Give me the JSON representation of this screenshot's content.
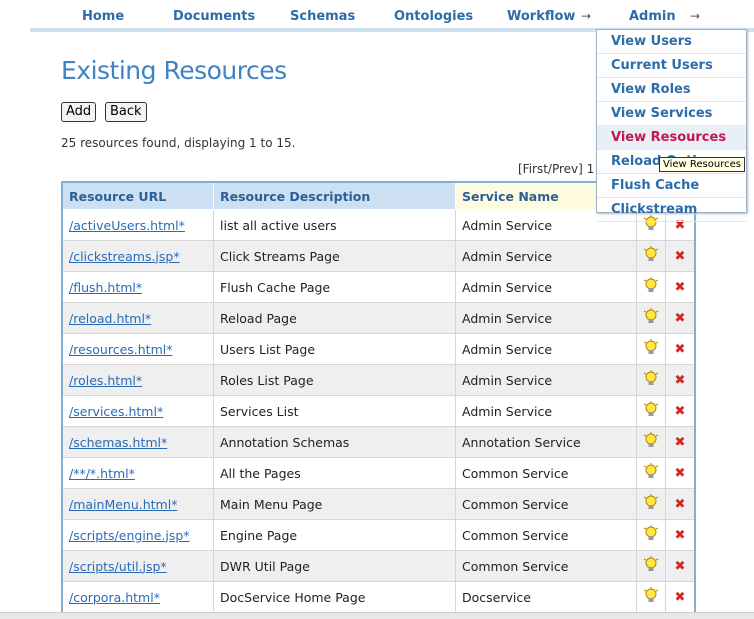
{
  "nav": {
    "items": [
      {
        "label": "Home"
      },
      {
        "label": "Documents"
      },
      {
        "label": "Schemas"
      },
      {
        "label": "Ontologies"
      },
      {
        "label": "Workflow"
      },
      {
        "label": "Admin"
      }
    ],
    "arrow": "→"
  },
  "page": {
    "title": "Existing Resources",
    "add_label": "Add",
    "back_label": "Back",
    "found_text": "25 resources found, displaying 1 to 15.",
    "pager_text": "[First/Prev] 1"
  },
  "table": {
    "headers": [
      "Resource URL",
      "Resource Description",
      "Service Name"
    ],
    "rows": [
      {
        "url": "/activeUsers.html*",
        "desc": "list all active users",
        "service": "Admin Service"
      },
      {
        "url": "/clickstreams.jsp*",
        "desc": "Click Streams Page",
        "service": "Admin Service"
      },
      {
        "url": "/flush.html*",
        "desc": "Flush Cache Page",
        "service": "Admin Service"
      },
      {
        "url": "/reload.html*",
        "desc": "Reload Page",
        "service": "Admin Service"
      },
      {
        "url": "/resources.html*",
        "desc": "Users List Page",
        "service": "Admin Service"
      },
      {
        "url": "/roles.html*",
        "desc": "Roles List Page",
        "service": "Admin Service"
      },
      {
        "url": "/services.html*",
        "desc": "Services List",
        "service": "Admin Service"
      },
      {
        "url": "/schemas.html*",
        "desc": "Annotation Schemas",
        "service": "Annotation Service"
      },
      {
        "url": "/**/*.html*",
        "desc": "All the Pages",
        "service": "Common Service"
      },
      {
        "url": "/mainMenu.html*",
        "desc": "Main Menu Page",
        "service": "Common Service"
      },
      {
        "url": "/scripts/engine.jsp*",
        "desc": "Engine Page",
        "service": "Common Service"
      },
      {
        "url": "/scripts/util.jsp*",
        "desc": "DWR Util Page",
        "service": "Common Service"
      },
      {
        "url": "/corpora.html*",
        "desc": "DocService Home Page",
        "service": "Docservice"
      }
    ],
    "edit_icon": "lightbulb-icon",
    "delete_icon": "delete-x-icon",
    "delete_glyph": "✖"
  },
  "admin_menu": {
    "items": [
      {
        "label": "View Users"
      },
      {
        "label": "Current Users"
      },
      {
        "label": "View Roles"
      },
      {
        "label": "View Services"
      },
      {
        "label": "View Resources"
      },
      {
        "label": "Reload Options"
      },
      {
        "label": "Flush Cache"
      },
      {
        "label": "Clickstream"
      }
    ],
    "active_index": 4
  },
  "tooltip": {
    "text": "View Resources"
  },
  "colors": {
    "link": "#2a6bb5",
    "heading": "#3f83c4",
    "active_menu": "#c2174b",
    "header_bg": "#cde0f1"
  }
}
